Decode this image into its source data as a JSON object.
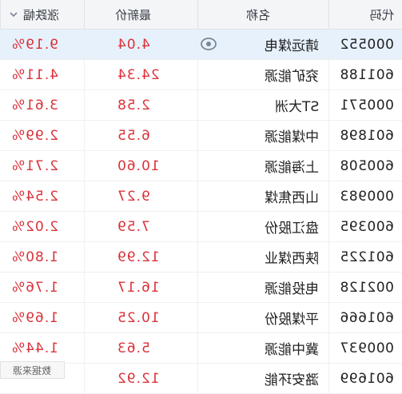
{
  "header": {
    "code_label": "代码",
    "name_label": "名称",
    "price_label": "最新价",
    "change_label": "涨跌幅"
  },
  "rows": [
    {
      "code": "000552",
      "name": "靖远煤电",
      "price": "4.04",
      "change": "9.19%",
      "selected": true
    },
    {
      "code": "601188",
      "name": "兖矿能源",
      "price": "24.34",
      "change": "4.11%"
    },
    {
      "code": "000571",
      "name": "ST大洲",
      "price": "2.58",
      "change": "3.61%"
    },
    {
      "code": "601898",
      "name": "中煤能源",
      "price": "6.55",
      "change": "2.99%"
    },
    {
      "code": "600508",
      "name": "上海能源",
      "price": "10.60",
      "change": "2.71%"
    },
    {
      "code": "000983",
      "name": "山西焦煤",
      "price": "9.27",
      "change": "2.54%"
    },
    {
      "code": "600395",
      "name": "盘江股份",
      "price": "7.59",
      "change": "2.02%"
    },
    {
      "code": "601225",
      "name": "陕西煤业",
      "price": "12.99",
      "change": "1.80%"
    },
    {
      "code": "002128",
      "name": "电投能源",
      "price": "16.17",
      "change": "1.76%"
    },
    {
      "code": "601666",
      "name": "平煤股份",
      "price": "10.25",
      "change": "1.69%"
    },
    {
      "code": "000937",
      "name": "冀中能源",
      "price": "5.63",
      "change": "1.44%"
    },
    {
      "code": "601699",
      "name": "潞安环能",
      "price": "12.92",
      "change": ""
    }
  ],
  "corner_tag": "数据来源",
  "colors": {
    "up": "#d9333b",
    "selected_row": "#e6f1fb",
    "header_bg": "#f3f5f7"
  },
  "icons": {
    "sort": "chevron-down-icon",
    "watch": "eye-icon"
  }
}
